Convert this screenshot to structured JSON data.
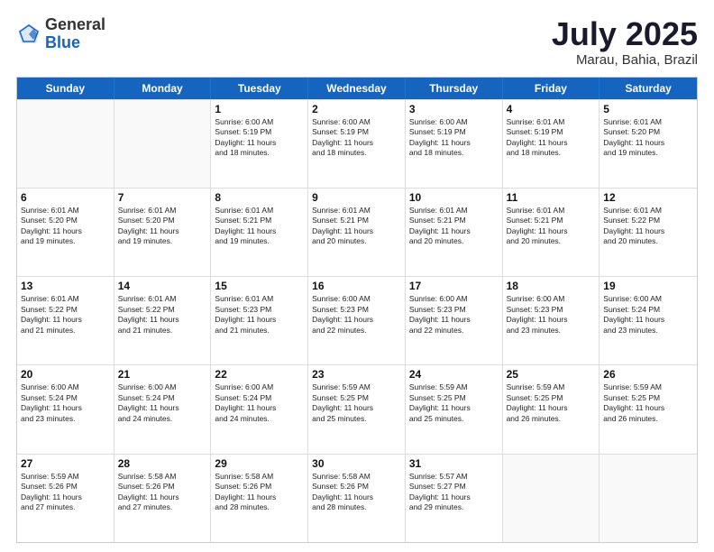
{
  "header": {
    "logo_general": "General",
    "logo_blue": "Blue",
    "title": "July 2025",
    "subtitle": "Marau, Bahia, Brazil"
  },
  "weekdays": [
    "Sunday",
    "Monday",
    "Tuesday",
    "Wednesday",
    "Thursday",
    "Friday",
    "Saturday"
  ],
  "weeks": [
    [
      {
        "day": "",
        "info": ""
      },
      {
        "day": "",
        "info": ""
      },
      {
        "day": "1",
        "info": "Sunrise: 6:00 AM\nSunset: 5:19 PM\nDaylight: 11 hours\nand 18 minutes."
      },
      {
        "day": "2",
        "info": "Sunrise: 6:00 AM\nSunset: 5:19 PM\nDaylight: 11 hours\nand 18 minutes."
      },
      {
        "day": "3",
        "info": "Sunrise: 6:00 AM\nSunset: 5:19 PM\nDaylight: 11 hours\nand 18 minutes."
      },
      {
        "day": "4",
        "info": "Sunrise: 6:01 AM\nSunset: 5:19 PM\nDaylight: 11 hours\nand 18 minutes."
      },
      {
        "day": "5",
        "info": "Sunrise: 6:01 AM\nSunset: 5:20 PM\nDaylight: 11 hours\nand 19 minutes."
      }
    ],
    [
      {
        "day": "6",
        "info": "Sunrise: 6:01 AM\nSunset: 5:20 PM\nDaylight: 11 hours\nand 19 minutes."
      },
      {
        "day": "7",
        "info": "Sunrise: 6:01 AM\nSunset: 5:20 PM\nDaylight: 11 hours\nand 19 minutes."
      },
      {
        "day": "8",
        "info": "Sunrise: 6:01 AM\nSunset: 5:21 PM\nDaylight: 11 hours\nand 19 minutes."
      },
      {
        "day": "9",
        "info": "Sunrise: 6:01 AM\nSunset: 5:21 PM\nDaylight: 11 hours\nand 20 minutes."
      },
      {
        "day": "10",
        "info": "Sunrise: 6:01 AM\nSunset: 5:21 PM\nDaylight: 11 hours\nand 20 minutes."
      },
      {
        "day": "11",
        "info": "Sunrise: 6:01 AM\nSunset: 5:21 PM\nDaylight: 11 hours\nand 20 minutes."
      },
      {
        "day": "12",
        "info": "Sunrise: 6:01 AM\nSunset: 5:22 PM\nDaylight: 11 hours\nand 20 minutes."
      }
    ],
    [
      {
        "day": "13",
        "info": "Sunrise: 6:01 AM\nSunset: 5:22 PM\nDaylight: 11 hours\nand 21 minutes."
      },
      {
        "day": "14",
        "info": "Sunrise: 6:01 AM\nSunset: 5:22 PM\nDaylight: 11 hours\nand 21 minutes."
      },
      {
        "day": "15",
        "info": "Sunrise: 6:01 AM\nSunset: 5:23 PM\nDaylight: 11 hours\nand 21 minutes."
      },
      {
        "day": "16",
        "info": "Sunrise: 6:00 AM\nSunset: 5:23 PM\nDaylight: 11 hours\nand 22 minutes."
      },
      {
        "day": "17",
        "info": "Sunrise: 6:00 AM\nSunset: 5:23 PM\nDaylight: 11 hours\nand 22 minutes."
      },
      {
        "day": "18",
        "info": "Sunrise: 6:00 AM\nSunset: 5:23 PM\nDaylight: 11 hours\nand 23 minutes."
      },
      {
        "day": "19",
        "info": "Sunrise: 6:00 AM\nSunset: 5:24 PM\nDaylight: 11 hours\nand 23 minutes."
      }
    ],
    [
      {
        "day": "20",
        "info": "Sunrise: 6:00 AM\nSunset: 5:24 PM\nDaylight: 11 hours\nand 23 minutes."
      },
      {
        "day": "21",
        "info": "Sunrise: 6:00 AM\nSunset: 5:24 PM\nDaylight: 11 hours\nand 24 minutes."
      },
      {
        "day": "22",
        "info": "Sunrise: 6:00 AM\nSunset: 5:24 PM\nDaylight: 11 hours\nand 24 minutes."
      },
      {
        "day": "23",
        "info": "Sunrise: 5:59 AM\nSunset: 5:25 PM\nDaylight: 11 hours\nand 25 minutes."
      },
      {
        "day": "24",
        "info": "Sunrise: 5:59 AM\nSunset: 5:25 PM\nDaylight: 11 hours\nand 25 minutes."
      },
      {
        "day": "25",
        "info": "Sunrise: 5:59 AM\nSunset: 5:25 PM\nDaylight: 11 hours\nand 26 minutes."
      },
      {
        "day": "26",
        "info": "Sunrise: 5:59 AM\nSunset: 5:25 PM\nDaylight: 11 hours\nand 26 minutes."
      }
    ],
    [
      {
        "day": "27",
        "info": "Sunrise: 5:59 AM\nSunset: 5:26 PM\nDaylight: 11 hours\nand 27 minutes."
      },
      {
        "day": "28",
        "info": "Sunrise: 5:58 AM\nSunset: 5:26 PM\nDaylight: 11 hours\nand 27 minutes."
      },
      {
        "day": "29",
        "info": "Sunrise: 5:58 AM\nSunset: 5:26 PM\nDaylight: 11 hours\nand 28 minutes."
      },
      {
        "day": "30",
        "info": "Sunrise: 5:58 AM\nSunset: 5:26 PM\nDaylight: 11 hours\nand 28 minutes."
      },
      {
        "day": "31",
        "info": "Sunrise: 5:57 AM\nSunset: 5:27 PM\nDaylight: 11 hours\nand 29 minutes."
      },
      {
        "day": "",
        "info": ""
      },
      {
        "day": "",
        "info": ""
      }
    ]
  ]
}
